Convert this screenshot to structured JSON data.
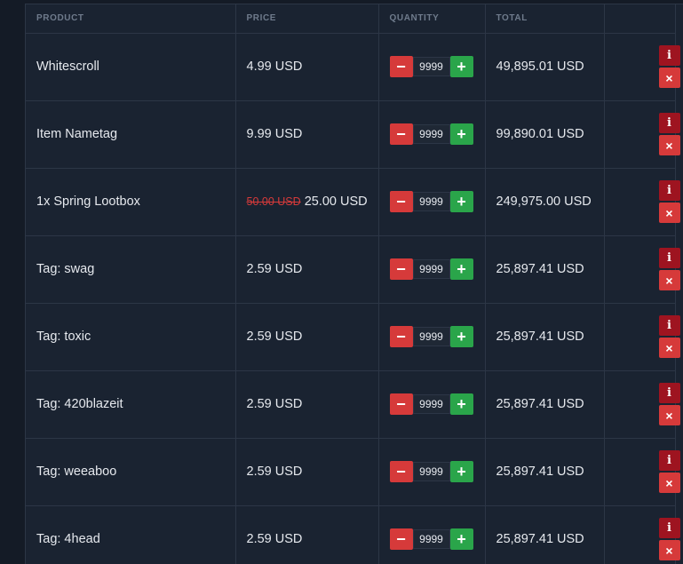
{
  "headers": {
    "product": "PRODUCT",
    "price": "PRICE",
    "quantity": "QUANTITY",
    "total": "TOTAL",
    "actions": ""
  },
  "icons": {
    "minus": "−",
    "plus": "+",
    "info": "i",
    "remove": "×"
  },
  "colors": {
    "minus_button": "#d63a3a",
    "plus_button": "#2aa54a",
    "info_button": "#9e1420",
    "remove_button": "#d63a3a",
    "strikethrough_price": "#d63a3a"
  },
  "rows": [
    {
      "product": "Whitescroll",
      "old_price": "",
      "price": "4.99 USD",
      "quantity": "9999",
      "total": "49,895.01 USD"
    },
    {
      "product": "Item Nametag",
      "old_price": "",
      "price": "9.99 USD",
      "quantity": "9999",
      "total": "99,890.01 USD"
    },
    {
      "product": "1x Spring Lootbox",
      "old_price": "50.00 USD",
      "price": "25.00 USD",
      "quantity": "9999",
      "total": "249,975.00 USD"
    },
    {
      "product": "Tag: swag",
      "old_price": "",
      "price": "2.59 USD",
      "quantity": "9999",
      "total": "25,897.41 USD"
    },
    {
      "product": "Tag: toxic",
      "old_price": "",
      "price": "2.59 USD",
      "quantity": "9999",
      "total": "25,897.41 USD"
    },
    {
      "product": "Tag: 420blazeit",
      "old_price": "",
      "price": "2.59 USD",
      "quantity": "9999",
      "total": "25,897.41 USD"
    },
    {
      "product": "Tag: weeaboo",
      "old_price": "",
      "price": "2.59 USD",
      "quantity": "9999",
      "total": "25,897.41 USD"
    },
    {
      "product": "Tag: 4head",
      "old_price": "",
      "price": "2.59 USD",
      "quantity": "9999",
      "total": "25,897.41 USD"
    }
  ]
}
